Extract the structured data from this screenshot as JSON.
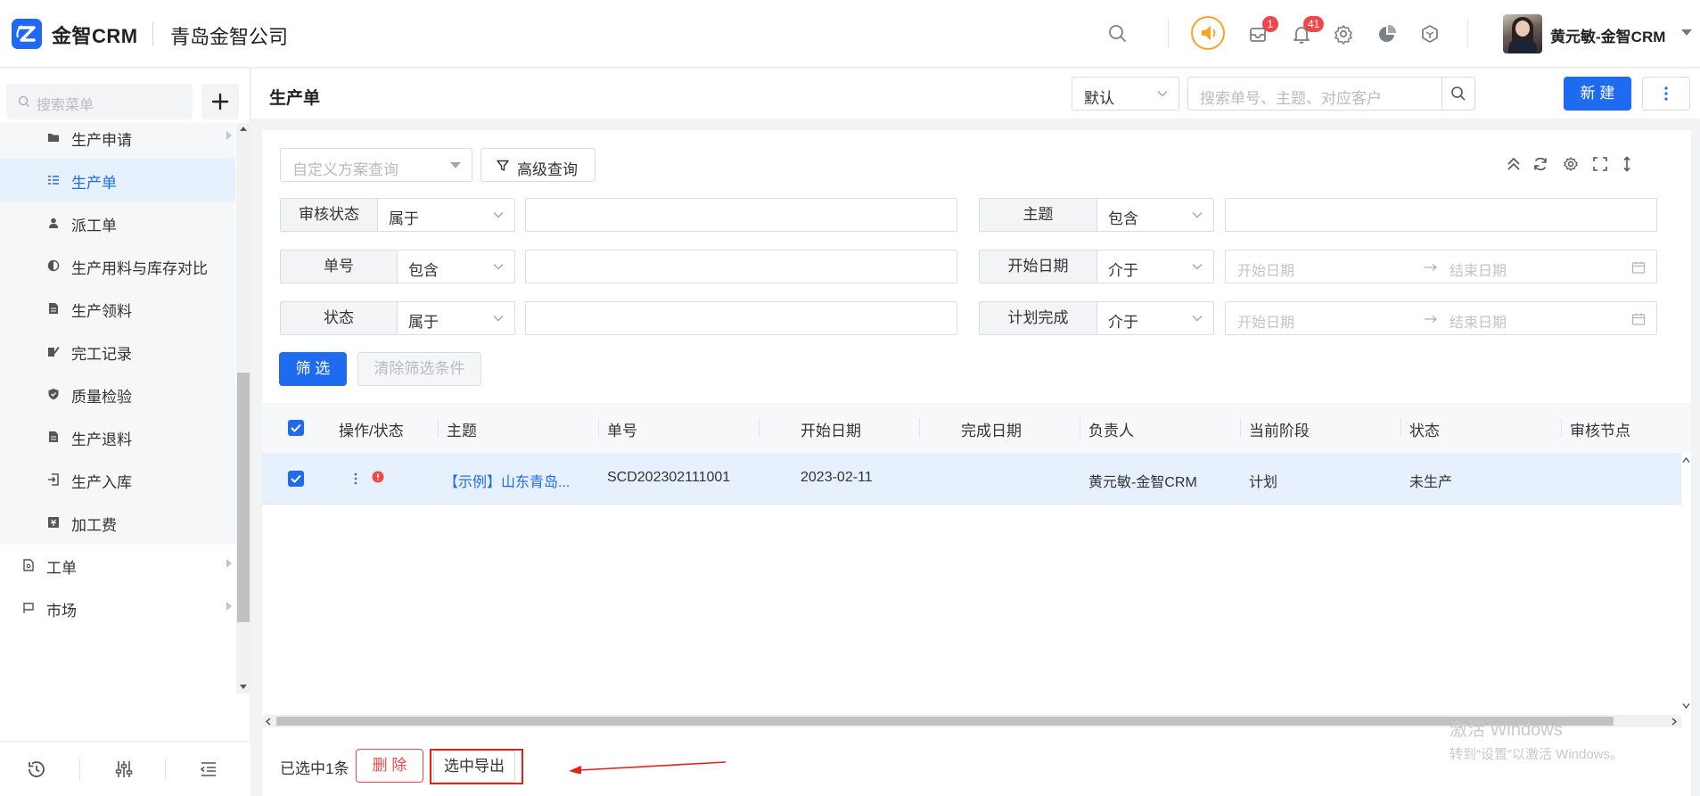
{
  "header": {
    "brand": "金智CRM",
    "company": "青岛金智公司",
    "mail_badge": "1",
    "bell_badge": "41",
    "username": "黄元敏-金智CRM"
  },
  "sidebar": {
    "search_placeholder": "搜索菜单",
    "items": [
      {
        "label": "生产申请",
        "icon": "folder-icon"
      },
      {
        "label": "生产单",
        "icon": "list-icon",
        "active": true
      },
      {
        "label": "派工单",
        "icon": "worker-icon"
      },
      {
        "label": "生产用料与库存对比",
        "icon": "contrast-icon"
      },
      {
        "label": "生产领料",
        "icon": "document-icon"
      },
      {
        "label": "完工记录",
        "icon": "edit-icon"
      },
      {
        "label": "质量检验",
        "icon": "shield-icon"
      },
      {
        "label": "生产退料",
        "icon": "document-icon"
      },
      {
        "label": "生产入库",
        "icon": "import-icon"
      },
      {
        "label": "加工费",
        "icon": "money-icon"
      }
    ],
    "groups": [
      {
        "label": "工单",
        "icon": "ticket-icon"
      },
      {
        "label": "市场",
        "icon": "flag-icon"
      }
    ]
  },
  "main": {
    "title": "生产单",
    "view_select": "默认",
    "search_placeholder": "搜索单号、主题、对应客户",
    "new_button": "新 建"
  },
  "filters": {
    "scheme_placeholder": "自定义方案查询",
    "advanced_label": "高级查询",
    "rows": [
      {
        "left": {
          "label": "审核状态",
          "op": "属于"
        },
        "right": {
          "label": "主题",
          "op": "包含"
        }
      },
      {
        "left": {
          "label": "单号",
          "op": "包含"
        },
        "right": {
          "label": "开始日期",
          "op": "介于",
          "start": "开始日期",
          "end": "结束日期"
        }
      },
      {
        "left": {
          "label": "状态",
          "op": "属于"
        },
        "right": {
          "label": "计划完成",
          "op": "介于",
          "start": "开始日期",
          "end": "结束日期"
        }
      }
    ],
    "filter_button": "筛 选",
    "clear_button": "清除筛选条件"
  },
  "table": {
    "columns": [
      "操作/状态",
      "主题",
      "单号",
      "开始日期",
      "完成日期",
      "负责人",
      "当前阶段",
      "状态",
      "审核节点"
    ],
    "rows": [
      {
        "subject": "【示例】山东青岛...",
        "number": "SCD202302111001",
        "start_date": "2023-02-11",
        "finish_date": "",
        "owner": "黄元敏-金智CRM",
        "stage": "计划",
        "status": "未生产",
        "audit": ""
      }
    ]
  },
  "footer": {
    "selected_text": "已选中1条",
    "delete_button": "删 除",
    "export_button": "选中导出"
  },
  "watermark": {
    "line1": "激活 Windows",
    "line2": "转到“设置”以激活 Windows。"
  },
  "colors": {
    "primary": "#1f6bf0",
    "danger": "#f0474b",
    "speaker": "#f5a623",
    "annotation": "#e2231a"
  }
}
